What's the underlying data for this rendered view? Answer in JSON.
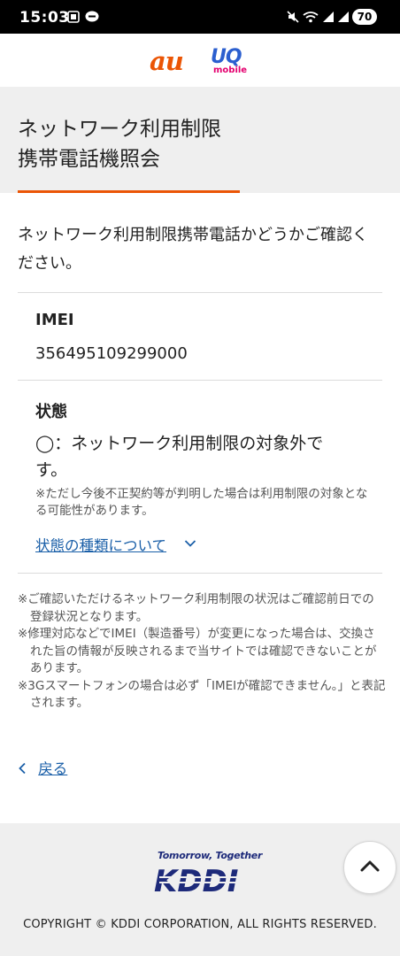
{
  "status_bar": {
    "time": "15:03",
    "battery": "70"
  },
  "brand": {
    "au": "au",
    "uq": "UQ",
    "uq_sub": "mobile"
  },
  "title": {
    "line1": "ネットワーク利用制限",
    "line2": "携帯電話機照会"
  },
  "intro": "ネットワーク利用制限携帯電話かどうかご確認ください。",
  "imei": {
    "label": "IMEI",
    "value": "356495109299000"
  },
  "state": {
    "label": "状態",
    "value": "◯：ネットワーク利用制限の対象外です。",
    "note": "※ただし今後不正契約等が判明した場合は利用制限の対象となる可能性があります。",
    "types_link": "状態の種類について"
  },
  "notes": [
    "※ご確認いただけるネットワーク利用制限の状況はご確認前日での登録状況となります。",
    "※修理対応などでIMEI（製造番号）が変更になった場合は、交換された旨の情報が反映されるまで当サイトでは確認できないことがあります。",
    "※3Gスマートフォンの場合は必ず「IMEIが確認できません。」と表記されます。"
  ],
  "back_link": "戻る",
  "footer": {
    "tagline": "Tomorrow, Together",
    "logo": "KDDI",
    "copyright": "COPYRIGHT © KDDI CORPORATION, ALL RIGHTS RESERVED."
  },
  "colors": {
    "accent": "#eb5505",
    "link": "#1a5fa8",
    "title_bg": "#efefef",
    "kddi_blue": "#1d2a7a"
  },
  "icons": {
    "chevron": "chevron-down-icon",
    "back": "chevron-left-icon",
    "scroll_top": "chevron-up-icon"
  }
}
